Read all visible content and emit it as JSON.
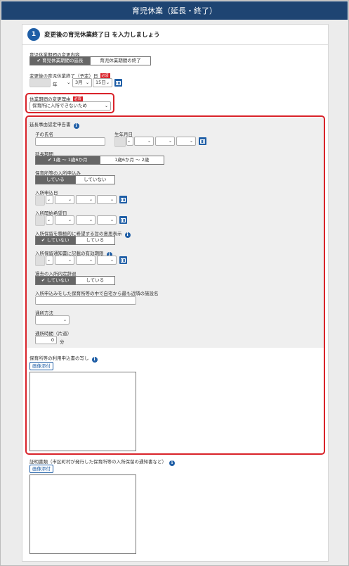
{
  "header": {
    "title": "育児休業（延長・終了）"
  },
  "step": {
    "number": "1",
    "title": "変更後の育児休業終了日 を入力しましょう"
  },
  "change_type": {
    "label": "育児休業期間の変更内容",
    "options": [
      "✔ 育児休業期間の延長",
      "育児休業期間の終了"
    ],
    "selected": 0
  },
  "end_date": {
    "label": "変更後の育児休業終了（予定）日",
    "required": "必須",
    "year": "",
    "year_unit": "年",
    "month": "3月",
    "day": "15日"
  },
  "reason": {
    "label": "休業期間の変更理由",
    "required": "必須",
    "value": "保育所に入所できないため"
  },
  "extension_form": {
    "title": "延長事由認定申告書",
    "child_name": {
      "label": "子の氏名",
      "value": ""
    },
    "birth_date": {
      "label": "生年月日"
    },
    "period": {
      "label": "延長期間",
      "options": [
        "✔ 1歳 ～ 1歳6か月",
        "1歳6か月 ～ 2歳"
      ],
      "selected": 0
    },
    "nursery_application": {
      "label": "保育所等の入所申込み",
      "options": [
        "している",
        "していない"
      ],
      "selected": 0
    },
    "application_date": {
      "label": "入所申込日"
    },
    "desired_date": {
      "label": "入所開始希望日"
    },
    "intent": {
      "label": "入所保留を積極的に希望する旨の意思表示",
      "options": [
        "✔ していない",
        "している"
      ],
      "selected": 0
    },
    "notice_validity": {
      "label": "入所保留通知書に記載の有効期限"
    },
    "past_decline": {
      "label": "過去の入所内定辞退",
      "options": [
        "✔ していない",
        "している"
      ],
      "selected": 0
    },
    "nearest_facility": {
      "label": "入所申込みをした保育所等の中で自宅から最も近隣の施設名",
      "value": ""
    },
    "commute": {
      "label": "通所方法",
      "value": ""
    },
    "commute_time": {
      "label": "通所時間（片道）",
      "value": "0",
      "unit": "分"
    },
    "nursery_copy": {
      "label": "保育所等の利用申込書の写し",
      "attach": "画像添付"
    }
  },
  "certificate": {
    "label": "証明書類（市区町村が発行した保育所等の入所保留の通知書など）",
    "attach": "画像添付"
  },
  "colors": {
    "header_bg": "#1e4472",
    "accent": "#1f5ea6",
    "highlight": "#d9232a"
  }
}
